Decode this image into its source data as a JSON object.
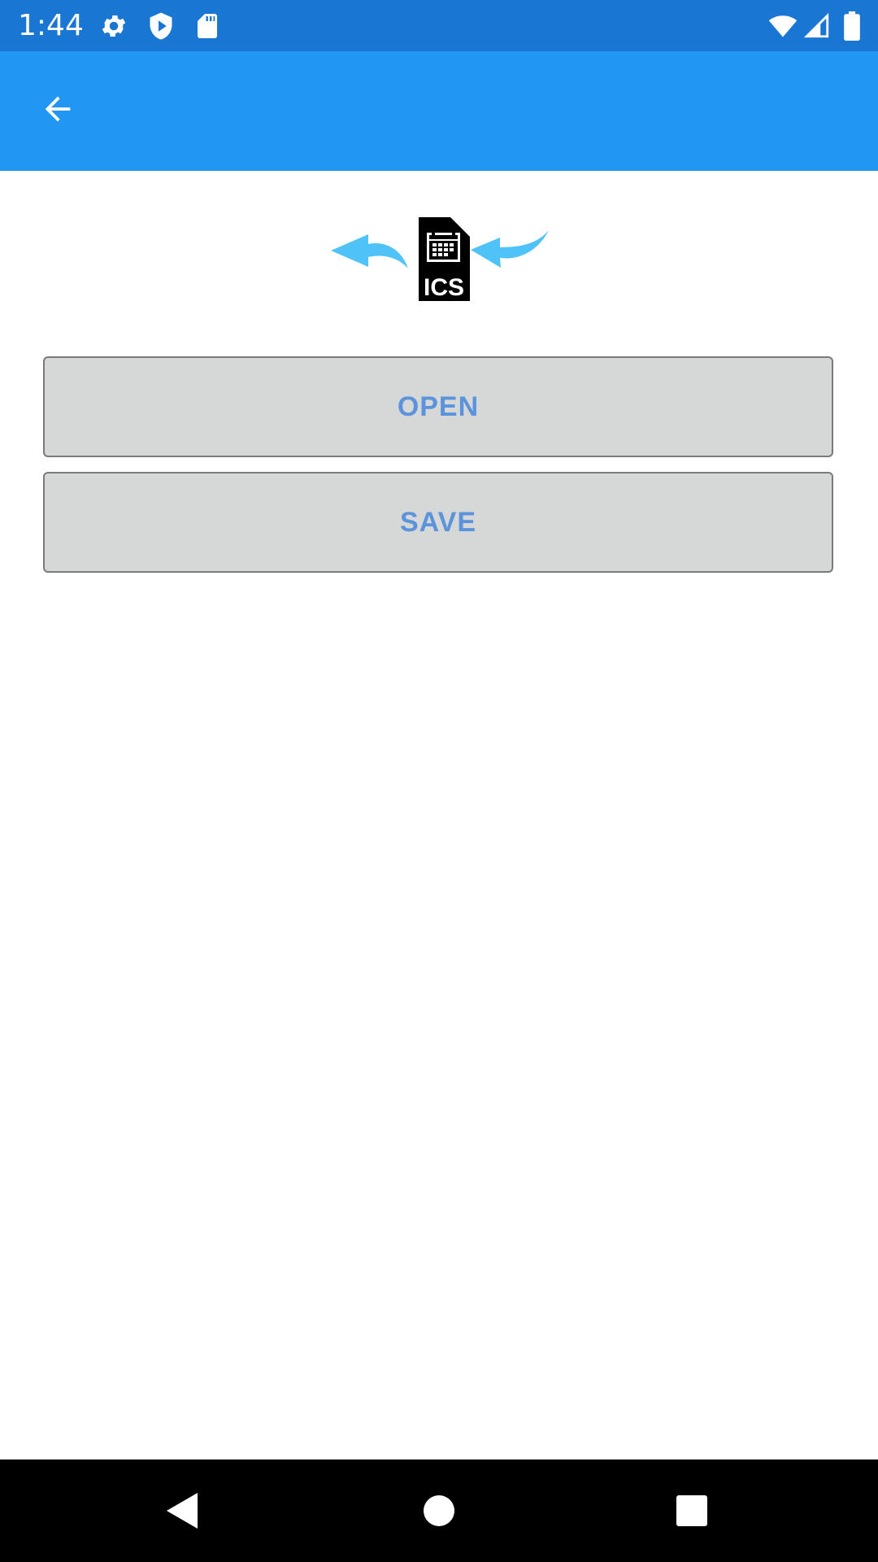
{
  "status_bar": {
    "time": "1:44",
    "left_icons": [
      "gear-icon",
      "shield-play-icon",
      "sd-card-icon"
    ],
    "right_icons": [
      "wifi-icon",
      "signal-icon",
      "battery-icon"
    ]
  },
  "app_bar": {
    "back_icon": "arrow-back-icon",
    "color": "#2196f3"
  },
  "logo": {
    "text": "ICS",
    "arrow_color": "#4fc3f7"
  },
  "buttons": {
    "open_label": "OPEN",
    "save_label": "SAVE",
    "label_color": "#5b93dc",
    "background": "#d6d7d7"
  },
  "nav_bar": {
    "icons": [
      "back-triangle-icon",
      "home-circle-icon",
      "recents-square-icon"
    ]
  }
}
